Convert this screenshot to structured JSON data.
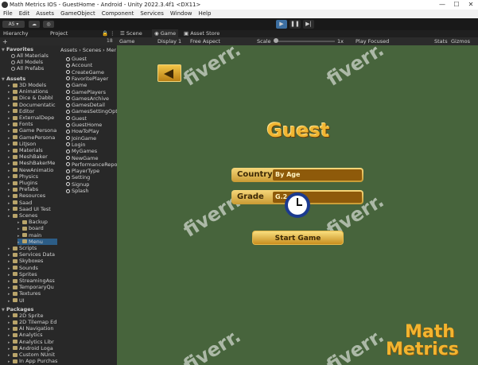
{
  "window": {
    "title": "Math Metrics IOS - GuestHome - Android - Unity 2022.3.4f1 <DX11>",
    "controls": [
      "—",
      "☐",
      "✕"
    ]
  },
  "menu": [
    "File",
    "Edit",
    "Assets",
    "GameObject",
    "Component",
    "Services",
    "Window",
    "Help"
  ],
  "toolbar": {
    "account": "AS ▾",
    "play_icons": [
      "▶",
      "❚❚",
      "▶|"
    ]
  },
  "hierarchy": {
    "tab": "Hierarchy",
    "favorites_header": "Favorites",
    "favorites": [
      "All Materials",
      "All Models",
      "All Prefabs"
    ],
    "assets_header": "Assets",
    "assets": [
      "3D Models",
      "Animations",
      "Dice & Dabbl",
      "Documentatic",
      "Editor",
      "ExternalDepe",
      "Fonts",
      "Game Persona",
      "GamePersona",
      "LitJson",
      "Materials",
      "MeshBaker",
      "MeshBakerMe",
      "NewAnimatio",
      "Physics",
      "Plugins",
      "Prefabs",
      "Resources",
      "Saad",
      "Saad UI Test",
      "Scenes",
      "Backup",
      "board",
      "main",
      "Menu",
      "Scripts",
      "Services Data",
      "Skyboxes",
      "Sounds",
      "Sprites",
      "StreamingAss",
      "TemporaryQu",
      "Textures",
      "UI"
    ],
    "packages_header": "Packages",
    "packages": [
      "2D Sprite",
      "2D Tilemap Ed",
      "AI Navigation",
      "Analytics",
      "Analytics Libr",
      "Android Loga",
      "Custom NUnit",
      "In App Purchasing"
    ]
  },
  "project": {
    "tab": "Project",
    "count": "18",
    "breadcrumb": [
      "Assets",
      "Scenes",
      "Menu"
    ],
    "scenes": [
      "Guest",
      "Account",
      "CreateGame",
      "FavoritePlayer",
      "Game",
      "GamePlayers",
      "GamesArchive",
      "GamesDetail",
      "GamesSettingOpt",
      "Guest",
      "GuestHome",
      "HowToPlay",
      "JoinGame",
      "Login",
      "MyGames",
      "NewGame",
      "PerformanceRepo",
      "PlayerType",
      "Setting",
      "Signup",
      "Splash"
    ]
  },
  "game_tabs": [
    "Scene",
    "Game",
    "Asset Store"
  ],
  "game_toolbar": {
    "mode": "Game",
    "display": "Display 1",
    "aspect": "Free Aspect",
    "scale_label": "Scale",
    "scale_value": "1x",
    "play_focused": "Play Focused",
    "stats": "Stats",
    "gizmos": "Gizmos"
  },
  "game": {
    "title": "Guest",
    "country_label": "Country",
    "country_value": "By Age",
    "grade_label": "Grade",
    "grade_value": "G.2",
    "start_button": "Start Game",
    "logo_line1": "Math",
    "logo_line2": "Metrics",
    "watermark": "fiverr."
  },
  "colors": {
    "game_bg": "#47643c",
    "accent_gold": "#f0b632",
    "field_value": "#8e5a0a",
    "selection": "#2c5d87"
  }
}
